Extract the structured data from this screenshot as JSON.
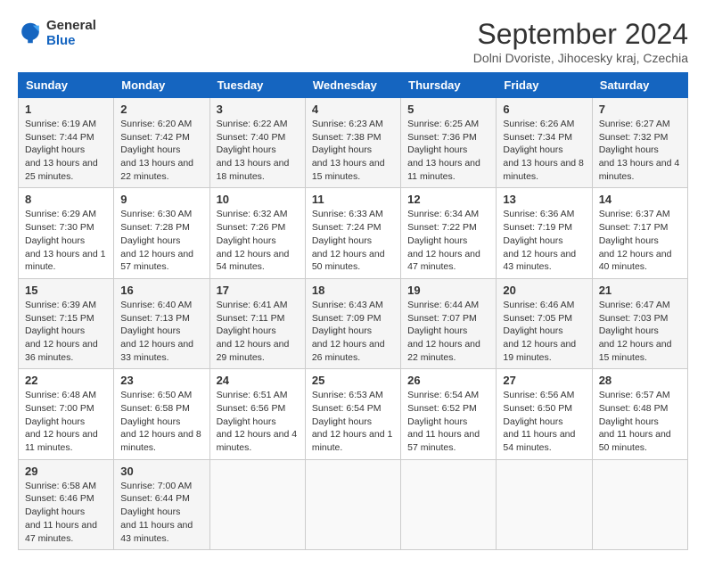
{
  "header": {
    "logo_general": "General",
    "logo_blue": "Blue",
    "month_title": "September 2024",
    "subtitle": "Dolni Dvoriste, Jihocesky kraj, Czechia"
  },
  "days_of_week": [
    "Sunday",
    "Monday",
    "Tuesday",
    "Wednesday",
    "Thursday",
    "Friday",
    "Saturday"
  ],
  "weeks": [
    [
      {
        "day": "1",
        "sunrise": "6:19 AM",
        "sunset": "7:44 PM",
        "daylight": "13 hours and 25 minutes."
      },
      {
        "day": "2",
        "sunrise": "6:20 AM",
        "sunset": "7:42 PM",
        "daylight": "13 hours and 22 minutes."
      },
      {
        "day": "3",
        "sunrise": "6:22 AM",
        "sunset": "7:40 PM",
        "daylight": "13 hours and 18 minutes."
      },
      {
        "day": "4",
        "sunrise": "6:23 AM",
        "sunset": "7:38 PM",
        "daylight": "13 hours and 15 minutes."
      },
      {
        "day": "5",
        "sunrise": "6:25 AM",
        "sunset": "7:36 PM",
        "daylight": "13 hours and 11 minutes."
      },
      {
        "day": "6",
        "sunrise": "6:26 AM",
        "sunset": "7:34 PM",
        "daylight": "13 hours and 8 minutes."
      },
      {
        "day": "7",
        "sunrise": "6:27 AM",
        "sunset": "7:32 PM",
        "daylight": "13 hours and 4 minutes."
      }
    ],
    [
      {
        "day": "8",
        "sunrise": "6:29 AM",
        "sunset": "7:30 PM",
        "daylight": "13 hours and 1 minute."
      },
      {
        "day": "9",
        "sunrise": "6:30 AM",
        "sunset": "7:28 PM",
        "daylight": "12 hours and 57 minutes."
      },
      {
        "day": "10",
        "sunrise": "6:32 AM",
        "sunset": "7:26 PM",
        "daylight": "12 hours and 54 minutes."
      },
      {
        "day": "11",
        "sunrise": "6:33 AM",
        "sunset": "7:24 PM",
        "daylight": "12 hours and 50 minutes."
      },
      {
        "day": "12",
        "sunrise": "6:34 AM",
        "sunset": "7:22 PM",
        "daylight": "12 hours and 47 minutes."
      },
      {
        "day": "13",
        "sunrise": "6:36 AM",
        "sunset": "7:19 PM",
        "daylight": "12 hours and 43 minutes."
      },
      {
        "day": "14",
        "sunrise": "6:37 AM",
        "sunset": "7:17 PM",
        "daylight": "12 hours and 40 minutes."
      }
    ],
    [
      {
        "day": "15",
        "sunrise": "6:39 AM",
        "sunset": "7:15 PM",
        "daylight": "12 hours and 36 minutes."
      },
      {
        "day": "16",
        "sunrise": "6:40 AM",
        "sunset": "7:13 PM",
        "daylight": "12 hours and 33 minutes."
      },
      {
        "day": "17",
        "sunrise": "6:41 AM",
        "sunset": "7:11 PM",
        "daylight": "12 hours and 29 minutes."
      },
      {
        "day": "18",
        "sunrise": "6:43 AM",
        "sunset": "7:09 PM",
        "daylight": "12 hours and 26 minutes."
      },
      {
        "day": "19",
        "sunrise": "6:44 AM",
        "sunset": "7:07 PM",
        "daylight": "12 hours and 22 minutes."
      },
      {
        "day": "20",
        "sunrise": "6:46 AM",
        "sunset": "7:05 PM",
        "daylight": "12 hours and 19 minutes."
      },
      {
        "day": "21",
        "sunrise": "6:47 AM",
        "sunset": "7:03 PM",
        "daylight": "12 hours and 15 minutes."
      }
    ],
    [
      {
        "day": "22",
        "sunrise": "6:48 AM",
        "sunset": "7:00 PM",
        "daylight": "12 hours and 11 minutes."
      },
      {
        "day": "23",
        "sunrise": "6:50 AM",
        "sunset": "6:58 PM",
        "daylight": "12 hours and 8 minutes."
      },
      {
        "day": "24",
        "sunrise": "6:51 AM",
        "sunset": "6:56 PM",
        "daylight": "12 hours and 4 minutes."
      },
      {
        "day": "25",
        "sunrise": "6:53 AM",
        "sunset": "6:54 PM",
        "daylight": "12 hours and 1 minute."
      },
      {
        "day": "26",
        "sunrise": "6:54 AM",
        "sunset": "6:52 PM",
        "daylight": "11 hours and 57 minutes."
      },
      {
        "day": "27",
        "sunrise": "6:56 AM",
        "sunset": "6:50 PM",
        "daylight": "11 hours and 54 minutes."
      },
      {
        "day": "28",
        "sunrise": "6:57 AM",
        "sunset": "6:48 PM",
        "daylight": "11 hours and 50 minutes."
      }
    ],
    [
      {
        "day": "29",
        "sunrise": "6:58 AM",
        "sunset": "6:46 PM",
        "daylight": "11 hours and 47 minutes."
      },
      {
        "day": "30",
        "sunrise": "7:00 AM",
        "sunset": "6:44 PM",
        "daylight": "11 hours and 43 minutes."
      },
      null,
      null,
      null,
      null,
      null
    ]
  ]
}
